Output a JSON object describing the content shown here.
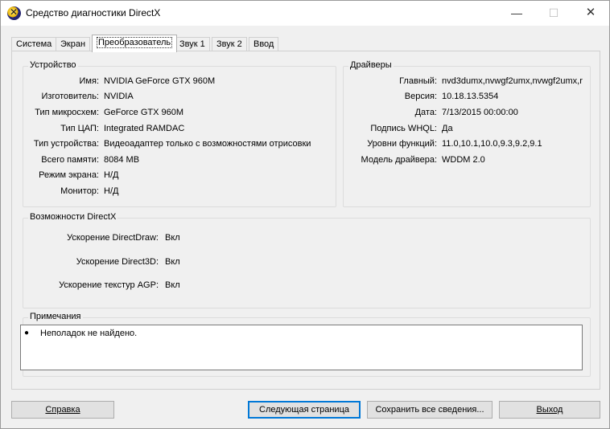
{
  "window": {
    "title": "Средство диагностики DirectX"
  },
  "tabs": [
    "Система",
    "Экран",
    "Преобразователь",
    "Звук 1",
    "Звук 2",
    "Ввод"
  ],
  "active_tab_index": 2,
  "device": {
    "title": "Устройство",
    "rows": [
      {
        "label": "Имя:",
        "value": "NVIDIA GeForce GTX 960M"
      },
      {
        "label": "Изготовитель:",
        "value": "NVIDIA"
      },
      {
        "label": "Тип микросхем:",
        "value": "GeForce GTX 960M"
      },
      {
        "label": "Тип ЦАП:",
        "value": "Integrated RAMDAC"
      },
      {
        "label": "Тип устройства:",
        "value": "Видеоадаптер только с возможностями отрисовки"
      },
      {
        "label": "Всего памяти:",
        "value": "8084 MB"
      },
      {
        "label": "Режим экрана:",
        "value": "Н/Д"
      },
      {
        "label": "Монитор:",
        "value": "Н/Д"
      }
    ]
  },
  "drivers": {
    "title": "Драйверы",
    "rows": [
      {
        "label": "Главный:",
        "value": "nvd3dumx,nvwgf2umx,nvwgf2umx,r"
      },
      {
        "label": "Версия:",
        "value": "10.18.13.5354"
      },
      {
        "label": "Дата:",
        "value": "7/13/2015 00:00:00"
      },
      {
        "label": "Подпись WHQL:",
        "value": "Да"
      },
      {
        "label": "Уровни функций:",
        "value": "11.0,10.1,10.0,9.3,9.2,9.1"
      },
      {
        "label": "Модель драйвера:",
        "value": "WDDM 2.0"
      }
    ]
  },
  "directx": {
    "title": "Возможности DirectX",
    "rows": [
      {
        "label": "Ускорение DirectDraw:",
        "value": "Вкл"
      },
      {
        "label": "Ускорение Direct3D:",
        "value": "Вкл"
      },
      {
        "label": "Ускорение текстур AGP:",
        "value": "Вкл"
      }
    ]
  },
  "notes": {
    "title": "Примечания",
    "items": [
      "Неполадок не найдено."
    ]
  },
  "buttons": {
    "help": "Справка",
    "next_page": "Следующая страница",
    "save_all": "Сохранить все сведения...",
    "exit": "Выход"
  }
}
